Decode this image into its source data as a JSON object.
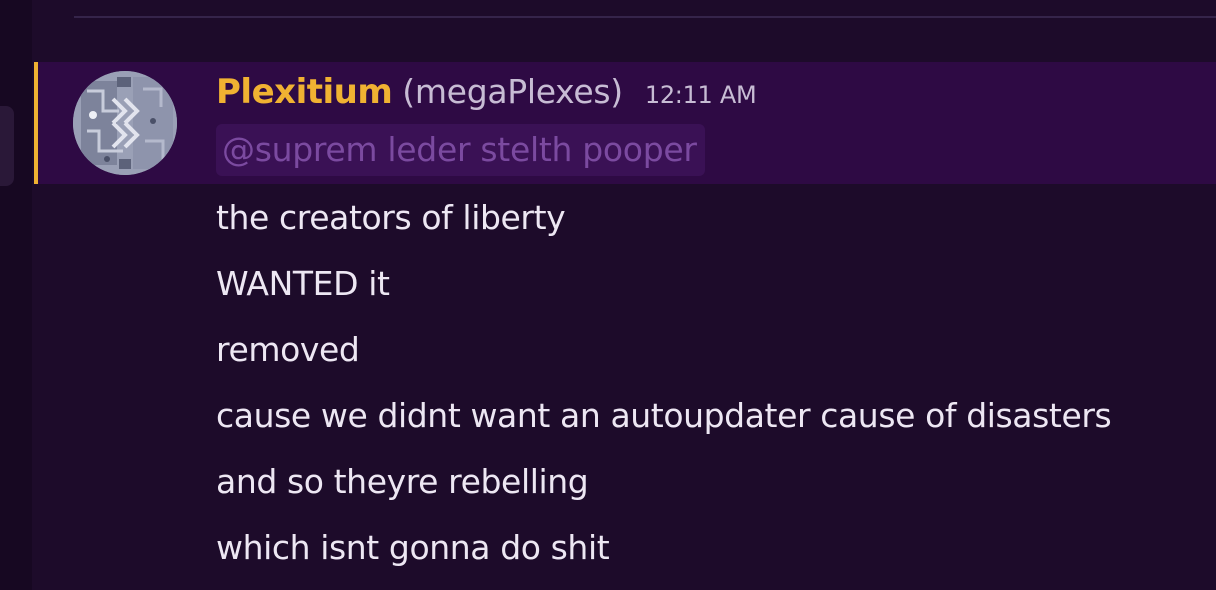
{
  "message": {
    "display_name": "Plexitium",
    "username": "(megaPlexes)",
    "timestamp": "12:11 AM",
    "reply_mention": "@suprem leder stelth pooper",
    "lines": [
      "the creators of liberty",
      "WANTED it",
      "removed",
      "cause we didnt want an autoupdater cause of disasters",
      "and so theyre rebelling",
      "which isnt gonna do shit"
    ]
  },
  "colors": {
    "background": "#1d0b2a",
    "mention_highlight": "#2e0a44",
    "mention_bar": "#f0b232",
    "display_name": "#f0b232",
    "reply_mention_text": "#7b4aa0",
    "message_text": "#ede7f3"
  },
  "icons": {
    "avatar": "circuit-board-avatar"
  }
}
